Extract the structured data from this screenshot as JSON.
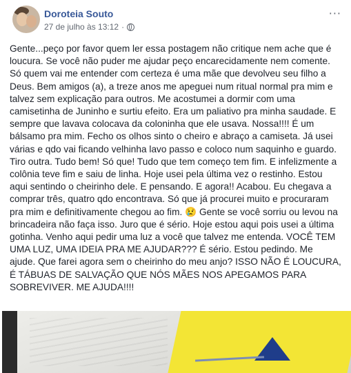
{
  "post": {
    "author": "Doroteia Souto",
    "timestamp": "27 de julho às 13:12",
    "separator": "·",
    "privacy_icon": "globe-icon",
    "more_label": "···",
    "text": "Gente...peço por favor quem ler essa postagem não critique nem ache que é\nloucura. Se você não puder me ajudar peço encarecidamente nem comente.\nSó quem vai me entender com certeza é uma mãe que devolveu seu filho a\nDeus. Bem amigos (a), a treze anos me apeguei num ritual normal pra mim e\ntalvez sem explicação para outros. Me acostumei a dormir com uma\ncamisetinha de Juninho e surtiu efeito. Era um paliativo pra minha saudade. E\nsempre que lavava colocava da coloninha que ele usava. Nossa!!!! É um\nbálsamo pra mim. Fecho os olhos sinto o cheiro e abraço a camiseta. Já usei\nvárias e qdo vai ficando velhinha lavo passo e coloco num saquinho e guardo.\nTiro outra. Tudo bem! Só que! Tudo que tem começo tem fim. E infelizmente a\ncolônia teve fim e saiu de linha. Hoje usei pela última vez o restinho. Estou\naqui sentindo o cheirinho dele. E pensando. E agora!! Acabou. Eu chegava a\ncomprar três, quatro qdo encontrava. Só que já procurei muito e procuraram\npra mim e definitivamente chegou ao fim. 😢 Gente se você sorriu ou levou na\nbrincadeira não faça isso. Juro que é sério. Hoje estou aqui pois usei a última\ngotinha. Venho aqui pedir uma luz a você que talvez me entenda. VOCÊ TEM\nUMA LUZ, UMA IDEIA PRA ME AJUDAR??? É sério. Estou pedindo. Me\najude. Que farei agora sem o cheirinho do meu anjo? ISSO NÃO É LOUCURA,\nÉ TÁBUAS DE SALVAÇÃO QUE NÓS MÃES NOS APEGAMOS PARA\nSOBREVIVER. ME AJUDA!!!!"
  },
  "colors": {
    "author_link": "#385898",
    "body_text": "#1d2129",
    "meta_text": "#616770"
  }
}
